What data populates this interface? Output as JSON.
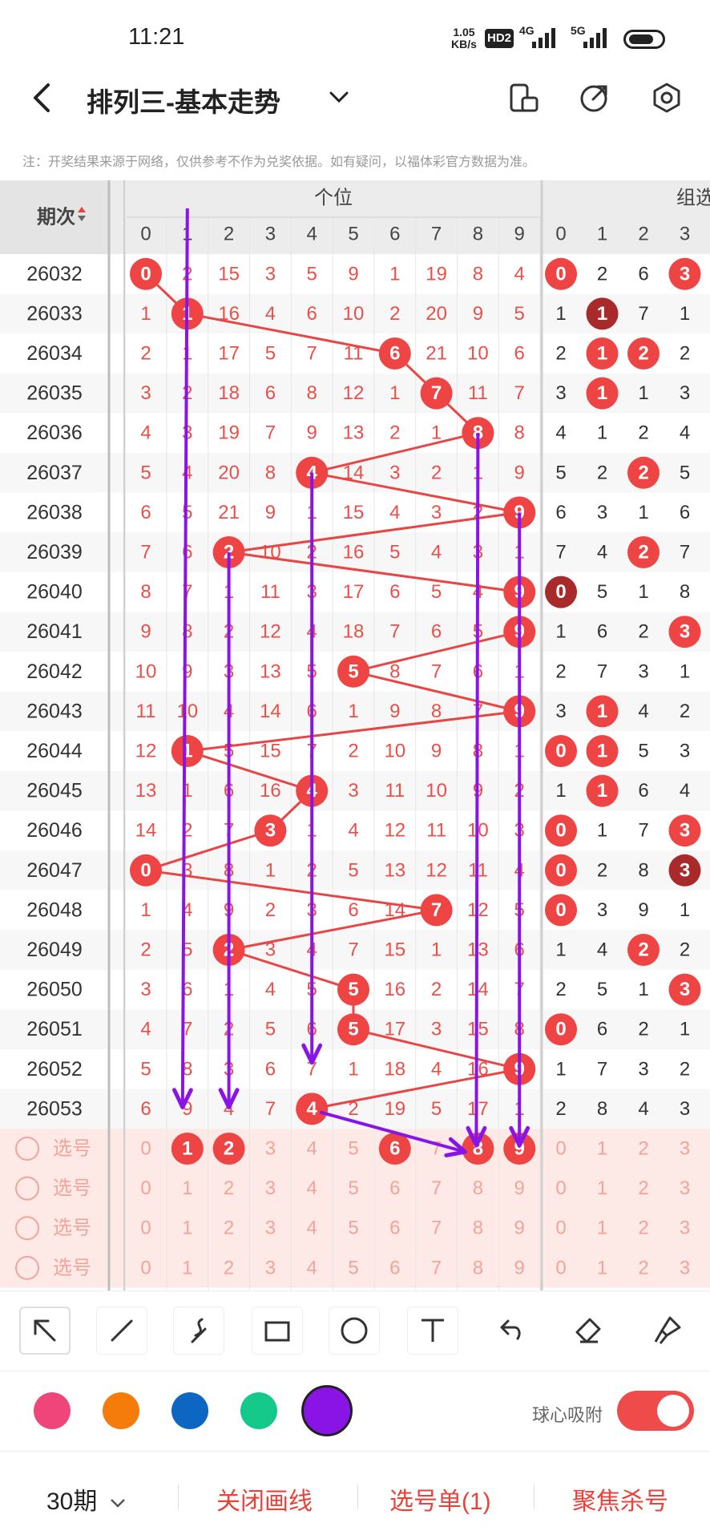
{
  "status": {
    "time": "11:21",
    "speed_value": "1.05",
    "speed_unit": "KB/s",
    "hd": "HD2",
    "net1": "4G",
    "net2": "5G"
  },
  "header": {
    "title": "排列三-基本走势",
    "notice": "注：开奖结果来源于网络，仅供参考不作为兑奖依据。如有疑问，以福体彩官方数据为准。"
  },
  "table": {
    "period_label": "期次",
    "group1_label": "个位",
    "group2_label": "组选",
    "digits": [
      "0",
      "1",
      "2",
      "3",
      "4",
      "5",
      "6",
      "7",
      "8",
      "9"
    ],
    "group2_digits": [
      "0",
      "1",
      "2",
      "3"
    ],
    "rows": [
      {
        "issue": "26032",
        "cells": [
          "0",
          "2",
          "15",
          "3",
          "5",
          "9",
          "1",
          "19",
          "8",
          "4"
        ],
        "hit": 0,
        "g": [
          "0",
          "2",
          "6",
          "3"
        ],
        "gh": [
          0,
          3
        ],
        "gd": []
      },
      {
        "issue": "26033",
        "cells": [
          "1",
          "1",
          "16",
          "4",
          "6",
          "10",
          "2",
          "20",
          "9",
          "5"
        ],
        "hit": 1,
        "g": [
          "1",
          "1",
          "7",
          "1"
        ],
        "gh": [],
        "gd": [
          1
        ]
      },
      {
        "issue": "26034",
        "cells": [
          "2",
          "1",
          "17",
          "5",
          "7",
          "11",
          "6",
          "21",
          "10",
          "6"
        ],
        "hit": 6,
        "g": [
          "2",
          "1",
          "2",
          "2"
        ],
        "gh": [
          1,
          2
        ],
        "gd": []
      },
      {
        "issue": "26035",
        "cells": [
          "3",
          "2",
          "18",
          "6",
          "8",
          "12",
          "1",
          "7",
          "11",
          "7"
        ],
        "hit": 7,
        "g": [
          "3",
          "1",
          "1",
          "3"
        ],
        "gh": [
          1
        ],
        "gd": []
      },
      {
        "issue": "26036",
        "cells": [
          "4",
          "3",
          "19",
          "7",
          "9",
          "13",
          "2",
          "1",
          "8",
          "8"
        ],
        "hit": 8,
        "g": [
          "4",
          "1",
          "2",
          "4"
        ],
        "gh": [],
        "gd": []
      },
      {
        "issue": "26037",
        "cells": [
          "5",
          "4",
          "20",
          "8",
          "4",
          "14",
          "3",
          "2",
          "1",
          "9"
        ],
        "hit": 4,
        "g": [
          "5",
          "2",
          "2",
          "5"
        ],
        "gh": [
          2
        ],
        "gd": []
      },
      {
        "issue": "26038",
        "cells": [
          "6",
          "5",
          "21",
          "9",
          "1",
          "15",
          "4",
          "3",
          "2",
          "9"
        ],
        "hit": 9,
        "g": [
          "6",
          "3",
          "1",
          "6"
        ],
        "gh": [],
        "gd": []
      },
      {
        "issue": "26039",
        "cells": [
          "7",
          "6",
          "2",
          "10",
          "2",
          "16",
          "5",
          "4",
          "3",
          "1"
        ],
        "hit": 2,
        "g": [
          "7",
          "4",
          "2",
          "7"
        ],
        "gh": [
          2
        ],
        "gd": []
      },
      {
        "issue": "26040",
        "cells": [
          "8",
          "7",
          "1",
          "11",
          "3",
          "17",
          "6",
          "5",
          "4",
          "9"
        ],
        "hit": 9,
        "g": [
          "0",
          "5",
          "1",
          "8"
        ],
        "gh": [],
        "gd": [
          0
        ]
      },
      {
        "issue": "26041",
        "cells": [
          "9",
          "8",
          "2",
          "12",
          "4",
          "18",
          "7",
          "6",
          "5",
          "9"
        ],
        "hit": 9,
        "g": [
          "1",
          "6",
          "2",
          "3"
        ],
        "gh": [
          3
        ],
        "gd": []
      },
      {
        "issue": "26042",
        "cells": [
          "10",
          "9",
          "3",
          "13",
          "5",
          "5",
          "8",
          "7",
          "6",
          "1"
        ],
        "hit": 5,
        "g": [
          "2",
          "7",
          "3",
          "1"
        ],
        "gh": [],
        "gd": []
      },
      {
        "issue": "26043",
        "cells": [
          "11",
          "10",
          "4",
          "14",
          "6",
          "1",
          "9",
          "8",
          "7",
          "9"
        ],
        "hit": 9,
        "g": [
          "3",
          "1",
          "4",
          "2"
        ],
        "gh": [
          1
        ],
        "gd": []
      },
      {
        "issue": "26044",
        "cells": [
          "12",
          "1",
          "5",
          "15",
          "7",
          "2",
          "10",
          "9",
          "8",
          "1"
        ],
        "hit": 1,
        "g": [
          "0",
          "1",
          "5",
          "3"
        ],
        "gh": [
          0,
          1
        ],
        "gd": []
      },
      {
        "issue": "26045",
        "cells": [
          "13",
          "1",
          "6",
          "16",
          "4",
          "3",
          "11",
          "10",
          "9",
          "2"
        ],
        "hit": 4,
        "g": [
          "1",
          "1",
          "6",
          "4"
        ],
        "gh": [
          1
        ],
        "gd": []
      },
      {
        "issue": "26046",
        "cells": [
          "14",
          "2",
          "7",
          "3",
          "1",
          "4",
          "12",
          "11",
          "10",
          "3"
        ],
        "hit": 3,
        "g": [
          "0",
          "1",
          "7",
          "3"
        ],
        "gh": [
          0,
          3
        ],
        "gd": []
      },
      {
        "issue": "26047",
        "cells": [
          "0",
          "3",
          "8",
          "1",
          "2",
          "5",
          "13",
          "12",
          "11",
          "4"
        ],
        "hit": 0,
        "g": [
          "0",
          "2",
          "8",
          "3"
        ],
        "gh": [
          0
        ],
        "gd": [
          3
        ]
      },
      {
        "issue": "26048",
        "cells": [
          "1",
          "4",
          "9",
          "2",
          "3",
          "6",
          "14",
          "7",
          "12",
          "5"
        ],
        "hit": 7,
        "g": [
          "0",
          "3",
          "9",
          "1"
        ],
        "gh": [
          0
        ],
        "gd": []
      },
      {
        "issue": "26049",
        "cells": [
          "2",
          "5",
          "2",
          "3",
          "4",
          "7",
          "15",
          "1",
          "13",
          "6"
        ],
        "hit": 2,
        "g": [
          "1",
          "4",
          "2",
          "2"
        ],
        "gh": [
          2
        ],
        "gd": []
      },
      {
        "issue": "26050",
        "cells": [
          "3",
          "6",
          "1",
          "4",
          "5",
          "5",
          "16",
          "2",
          "14",
          "7"
        ],
        "hit": 5,
        "g": [
          "2",
          "5",
          "1",
          "3"
        ],
        "gh": [
          3
        ],
        "gd": []
      },
      {
        "issue": "26051",
        "cells": [
          "4",
          "7",
          "2",
          "5",
          "6",
          "5",
          "17",
          "3",
          "15",
          "8"
        ],
        "hit": 5,
        "g": [
          "0",
          "6",
          "2",
          "1"
        ],
        "gh": [
          0
        ],
        "gd": []
      },
      {
        "issue": "26052",
        "cells": [
          "5",
          "8",
          "3",
          "6",
          "7",
          "1",
          "18",
          "4",
          "16",
          "9"
        ],
        "hit": 9,
        "g": [
          "1",
          "7",
          "3",
          "2"
        ],
        "gh": [],
        "gd": []
      },
      {
        "issue": "26053",
        "cells": [
          "6",
          "9",
          "4",
          "7",
          "4",
          "2",
          "19",
          "5",
          "17",
          "1"
        ],
        "hit": 4,
        "g": [
          "2",
          "8",
          "4",
          "3"
        ],
        "gh": [],
        "gd": []
      }
    ],
    "pick_label": "选号",
    "pick_first_selected": [
      1,
      2,
      6,
      8,
      9
    ]
  },
  "toolbar": {
    "tools": [
      "pointer-tool",
      "line-tool",
      "curve-tool",
      "rect-tool",
      "circle-tool",
      "text-tool",
      "undo-tool",
      "eraser-tool",
      "clear-tool"
    ]
  },
  "palette": {
    "colors": [
      "#f0457a",
      "#f57b0a",
      "#0d66c2",
      "#15c98b",
      "#8a14e6"
    ],
    "snap_label": "球心吸附"
  },
  "bottom": {
    "period": "30期",
    "close_lines": "关闭画线",
    "picks": "选号单(1)",
    "focus": "聚焦杀号"
  },
  "colors": {
    "accent": "#e8423a",
    "ball": "#ee4444",
    "dark_ball": "#a82a2a",
    "purple": "#8a14e6"
  }
}
